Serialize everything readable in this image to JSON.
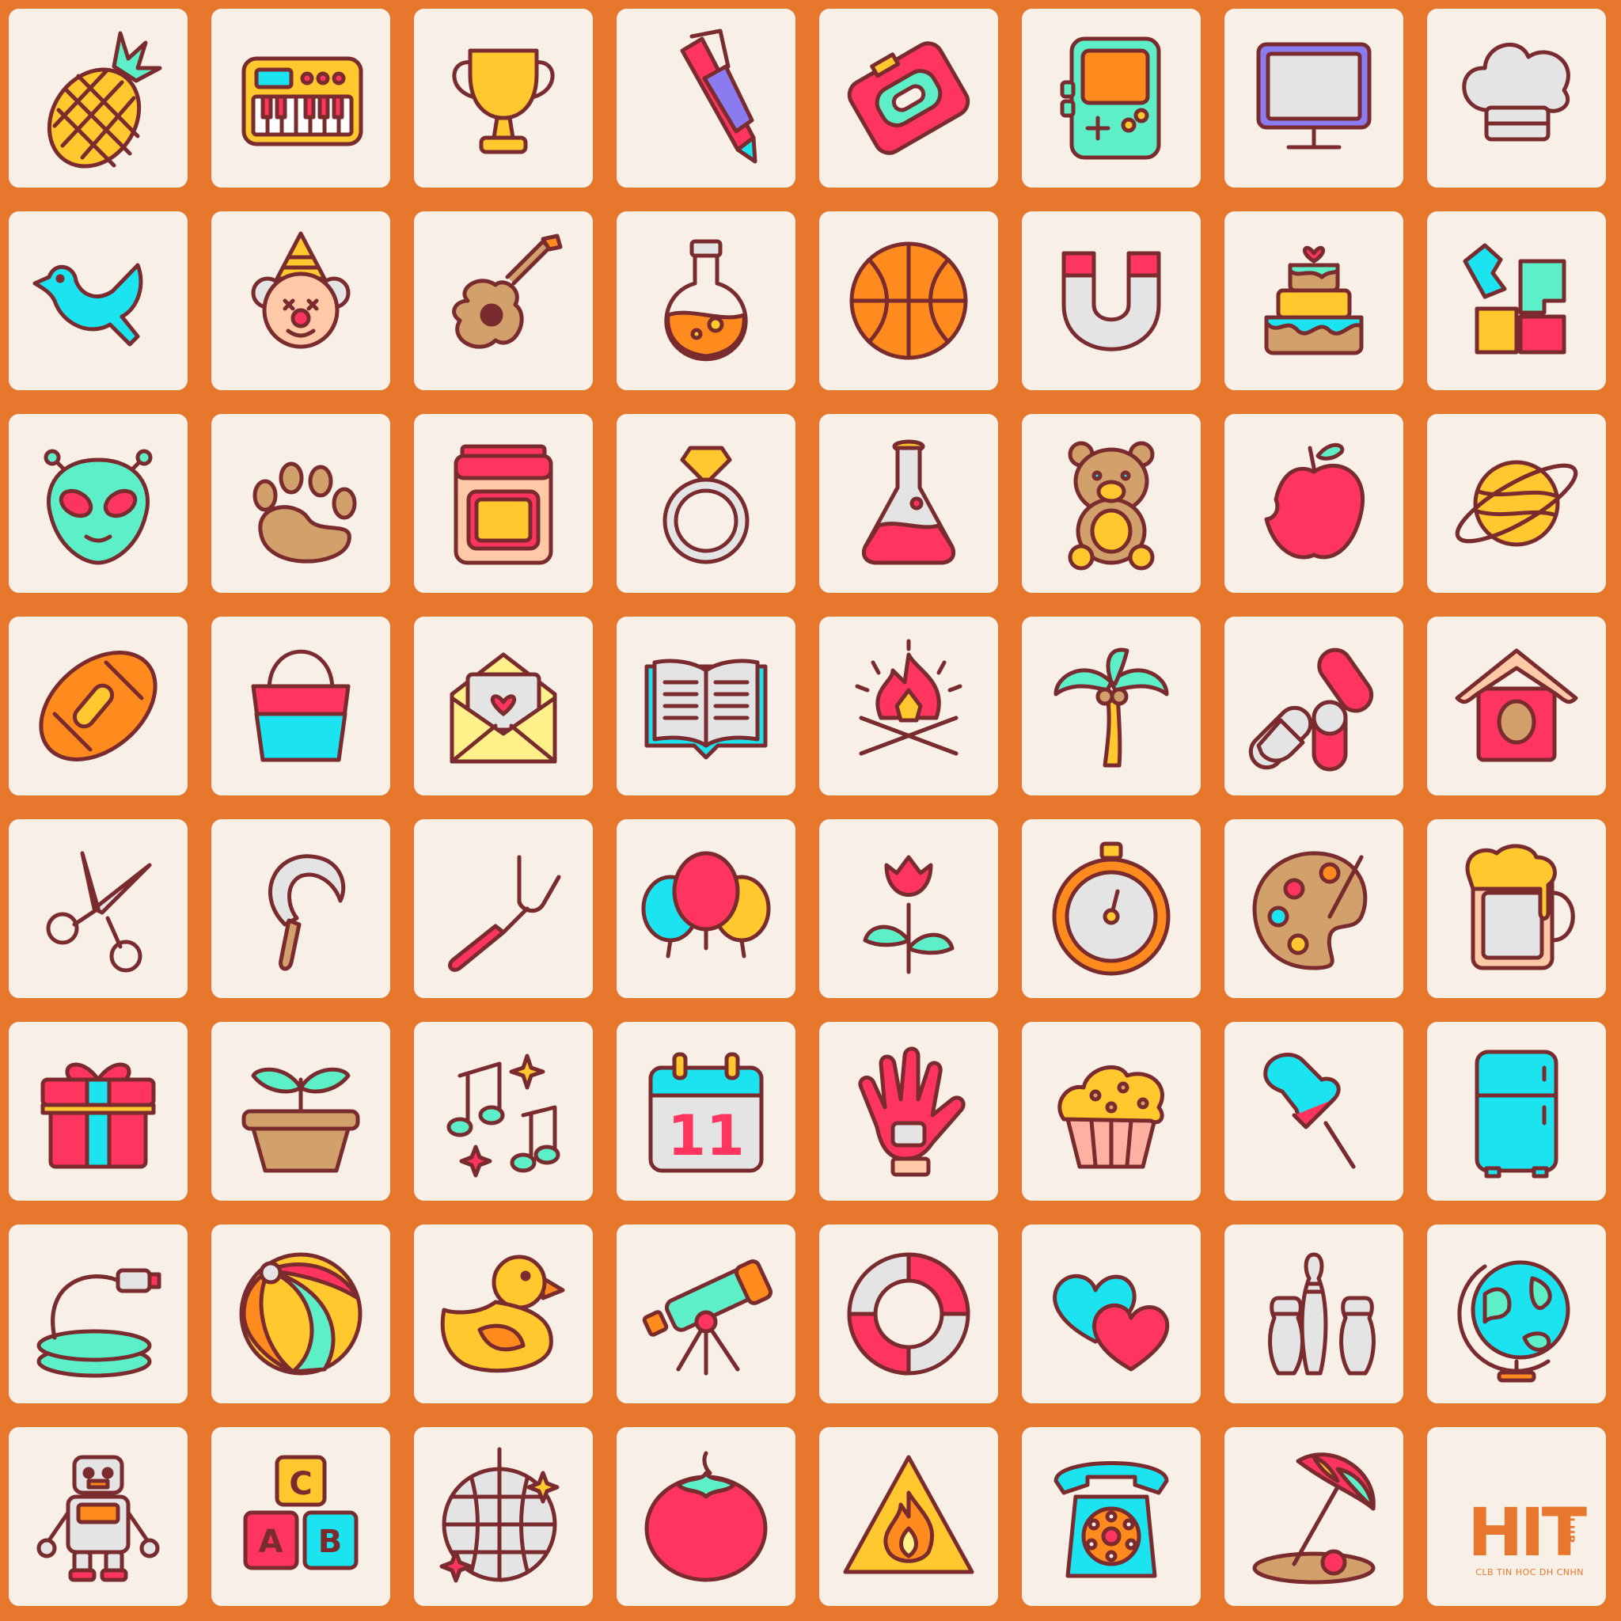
{
  "board": {
    "rows": 8,
    "cols": 8,
    "tiles": [
      {
        "icon": "pineapple-icon"
      },
      {
        "icon": "keyboard-piano-icon"
      },
      {
        "icon": "trophy-icon"
      },
      {
        "icon": "pen-icon"
      },
      {
        "icon": "cassette-tape-icon"
      },
      {
        "icon": "game-console-icon"
      },
      {
        "icon": "monitor-icon"
      },
      {
        "icon": "chef-hat-icon"
      },
      {
        "icon": "dove-icon"
      },
      {
        "icon": "clown-icon"
      },
      {
        "icon": "guitar-icon"
      },
      {
        "icon": "round-flask-icon"
      },
      {
        "icon": "basketball-icon"
      },
      {
        "icon": "magnet-icon"
      },
      {
        "icon": "cake-icon"
      },
      {
        "icon": "puzzle-icon"
      },
      {
        "icon": "alien-icon"
      },
      {
        "icon": "paw-print-icon"
      },
      {
        "icon": "oven-icon"
      },
      {
        "icon": "diamond-ring-icon"
      },
      {
        "icon": "erlenmeyer-flask-icon"
      },
      {
        "icon": "teddy-bear-icon"
      },
      {
        "icon": "apple-icon"
      },
      {
        "icon": "planet-icon"
      },
      {
        "icon": "football-icon"
      },
      {
        "icon": "bucket-icon"
      },
      {
        "icon": "love-letter-icon"
      },
      {
        "icon": "open-book-icon"
      },
      {
        "icon": "campfire-icon"
      },
      {
        "icon": "palm-tree-icon"
      },
      {
        "icon": "pills-icon"
      },
      {
        "icon": "birdhouse-icon"
      },
      {
        "icon": "scissors-icon"
      },
      {
        "icon": "sickle-icon"
      },
      {
        "icon": "tuning-fork-icon"
      },
      {
        "icon": "balloons-icon"
      },
      {
        "icon": "rose-icon"
      },
      {
        "icon": "stopwatch-icon"
      },
      {
        "icon": "paint-palette-icon"
      },
      {
        "icon": "beer-mug-icon"
      },
      {
        "icon": "gift-box-icon"
      },
      {
        "icon": "potted-sprout-icon"
      },
      {
        "icon": "music-notes-icon"
      },
      {
        "icon": "calendar-icon",
        "text": "11"
      },
      {
        "icon": "glove-icon"
      },
      {
        "icon": "muffin-icon"
      },
      {
        "icon": "push-pin-icon"
      },
      {
        "icon": "refrigerator-icon"
      },
      {
        "icon": "garden-hose-icon"
      },
      {
        "icon": "beach-ball-icon"
      },
      {
        "icon": "rubber-duck-icon"
      },
      {
        "icon": "telescope-icon"
      },
      {
        "icon": "life-ring-icon"
      },
      {
        "icon": "hearts-icon"
      },
      {
        "icon": "bowling-pins-icon"
      },
      {
        "icon": "globe-icon"
      },
      {
        "icon": "robot-icon"
      },
      {
        "icon": "abc-blocks-icon",
        "letters": [
          "C",
          "A",
          "B"
        ]
      },
      {
        "icon": "disco-ball-icon"
      },
      {
        "icon": "tomato-icon"
      },
      {
        "icon": "fire-warning-icon"
      },
      {
        "icon": "rotary-phone-icon"
      },
      {
        "icon": "beach-umbrella-icon"
      },
      {
        "icon": "hit-club-logo"
      }
    ]
  },
  "logo": {
    "main": "HIT",
    "side": "CLUB",
    "subtitle": "CLB TIN HOC DH CNHN"
  },
  "colors": {
    "grid_orange": "#E8772E",
    "tile_background": "#F8EFE6",
    "outline": "#7A2B2E",
    "red": "#FF3560",
    "teal": "#5DF0C8",
    "cyan": "#1BE3F0",
    "yellow": "#FFC82E",
    "orange": "#FF8A1E",
    "grey": "#E4E4E4",
    "brown": "#D2A06A",
    "purple": "#8B7BF0"
  }
}
